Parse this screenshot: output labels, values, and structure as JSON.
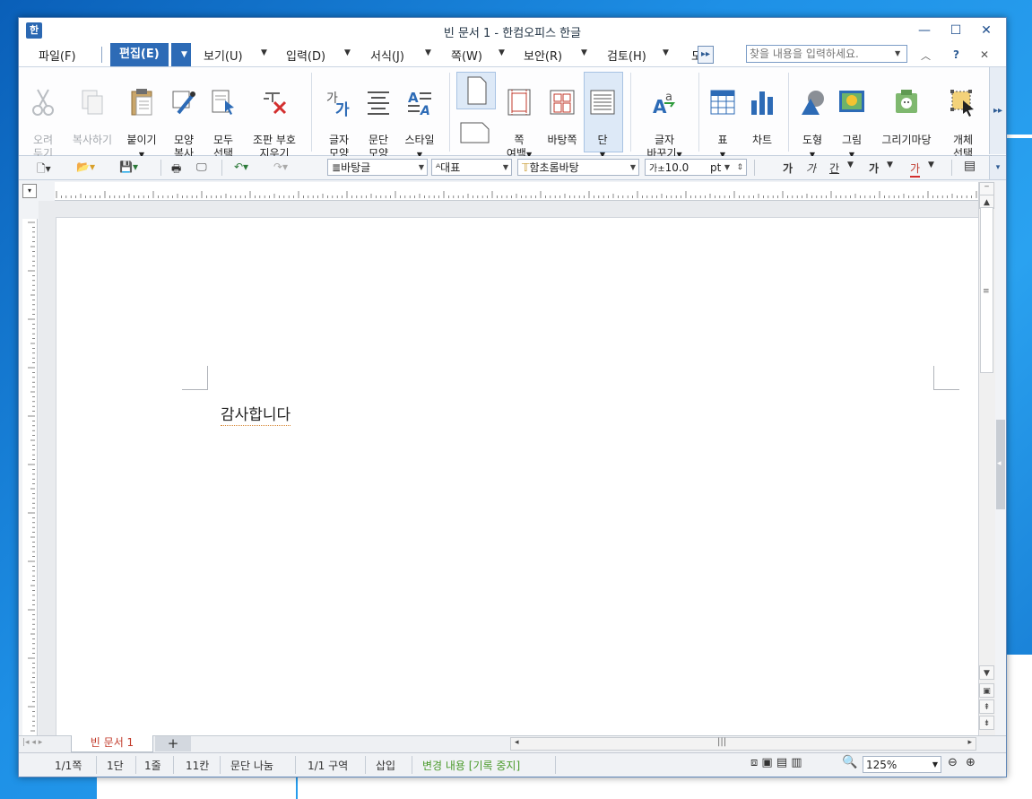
{
  "window": {
    "title": "빈 문서 1 - 한컴오피스 한글",
    "app_icon": "한",
    "min": "—",
    "max": "☐",
    "close": "✕"
  },
  "menu": {
    "items": [
      "파일(F)",
      "편집(E)",
      "보기(U)",
      "입력(D)",
      "서식(J)",
      "쪽(W)",
      "보안(R)",
      "검토(H)",
      "도"
    ],
    "active": "편집(E)"
  },
  "search": {
    "placeholder": "찾을 내용을 입력하세요."
  },
  "ribbon": {
    "cut": "오려\n두기",
    "copy": "복사하기",
    "paste": "붙이기",
    "format_copy": "모양\n복사",
    "select_all": "모두\n선택",
    "delete_marks": "조판 부호\n지우기",
    "char_shape": "글자\n모양",
    "para_shape": "문단\n모양",
    "style": "스타일",
    "page_margin": "쪽\n여백",
    "background_page": "바탕쪽",
    "columns": "단",
    "char_change": "글자\n바꾸기",
    "table": "표",
    "chart": "차트",
    "shape": "도형",
    "picture": "그림",
    "draw_board": "그리기마당",
    "select_object": "개체\n선택"
  },
  "toolbar2": {
    "style_combo": "바탕글",
    "lang_combo": "대표",
    "font_combo": "함초롬바탕",
    "size_value": "10.0",
    "size_unit": "pt",
    "bold": "가",
    "italic": "가",
    "underline": "간",
    "strike": "가",
    "color": "가"
  },
  "document": {
    "body_text": "감사합니다",
    "tab_name": "빈 문서 1",
    "add_tab": "+"
  },
  "status": {
    "page": "1/1쪽",
    "column": "1단",
    "line": "1줄",
    "col": "11칸",
    "break": "문단 나눔",
    "section": "1/1 구역",
    "mode": "삽입",
    "track": "변경 내용 [기록 중지]",
    "zoom": "125%"
  },
  "colors": {
    "accent": "#2d6bb6",
    "track_text": "#4a9a2a",
    "tab_text": "#c23a2a"
  }
}
